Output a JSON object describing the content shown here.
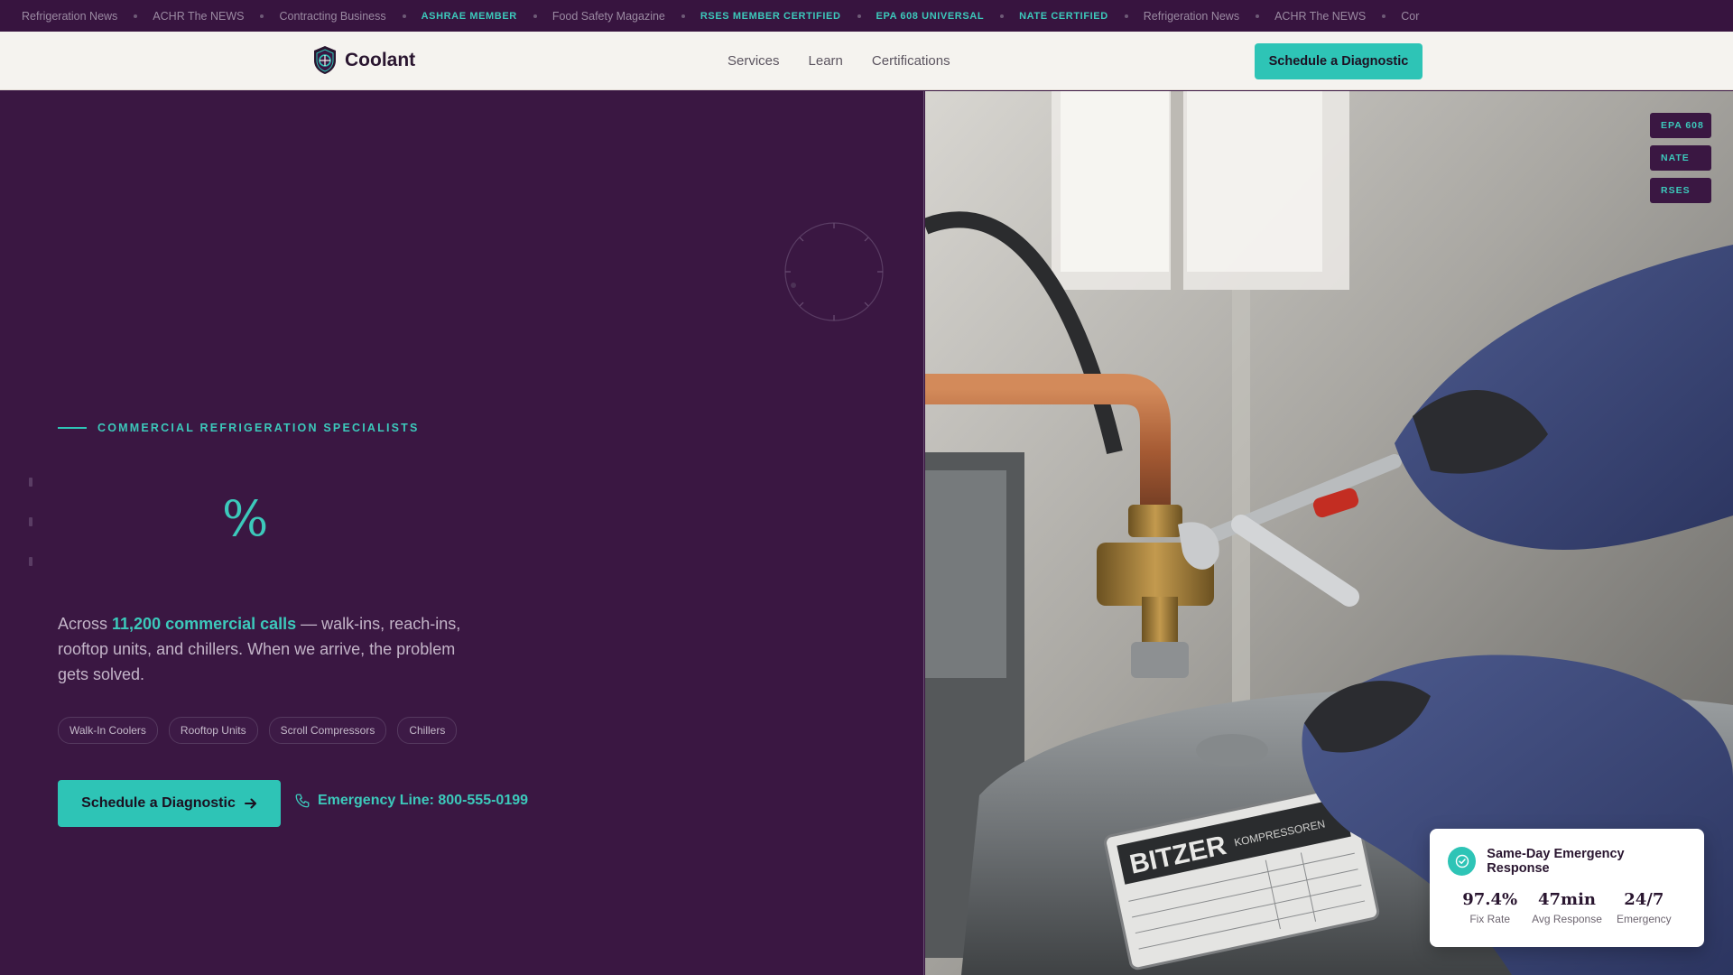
{
  "ticker": {
    "items": [
      {
        "text": "Refrigeration News",
        "highlight": false
      },
      {
        "text": "ACHR The NEWS",
        "highlight": false
      },
      {
        "text": "Contracting Business",
        "highlight": false
      },
      {
        "text": "ASHRAE MEMBER",
        "highlight": true
      },
      {
        "text": "Food Safety Magazine",
        "highlight": false
      },
      {
        "text": "RSES MEMBER CERTIFIED",
        "highlight": true
      },
      {
        "text": "EPA 608 UNIVERSAL",
        "highlight": true
      },
      {
        "text": "NATE CERTIFIED",
        "highlight": true
      },
      {
        "text": "Refrigeration News",
        "highlight": false
      },
      {
        "text": "ACHR The NEWS",
        "highlight": false
      },
      {
        "text": "Cor",
        "highlight": false
      }
    ]
  },
  "nav": {
    "brand": "Coolant",
    "links": [
      "Services",
      "Learn",
      "Certifications"
    ],
    "cta": "Schedule a Diagnostic"
  },
  "hero": {
    "eyebrow": "COMMERCIAL REFRIGERATION SPECIALISTS",
    "big_symbol": "%",
    "lede_before": "Across ",
    "lede_highlight": "11,200 commercial calls",
    "lede_after": " — walk-ins, reach-ins, rooftop units, and chillers. When we arrive, the problem gets solved.",
    "chips": [
      "Walk-In Coolers",
      "Rooftop Units",
      "Scroll Compressors",
      "Chillers"
    ],
    "cta_primary": "Schedule a Diagnostic",
    "emergency": "Emergency Line: 800-555-0199"
  },
  "photo": {
    "badges": [
      "EPA 608",
      "NATE",
      "RSES"
    ],
    "compressor_brand": "BITZER",
    "compressor_sub": "KOMPRESSOREN"
  },
  "stat_card": {
    "title": "Same-Day Emergency Response",
    "stats": [
      {
        "value": "97.4%",
        "label": "Fix Rate"
      },
      {
        "value": "47min",
        "label": "Avg Response"
      },
      {
        "value": "24/7",
        "label": "Emergency"
      }
    ]
  },
  "colors": {
    "accent": "#2ec4b6",
    "plum": "#3a1742",
    "nav_bg": "#f5f3ef"
  }
}
